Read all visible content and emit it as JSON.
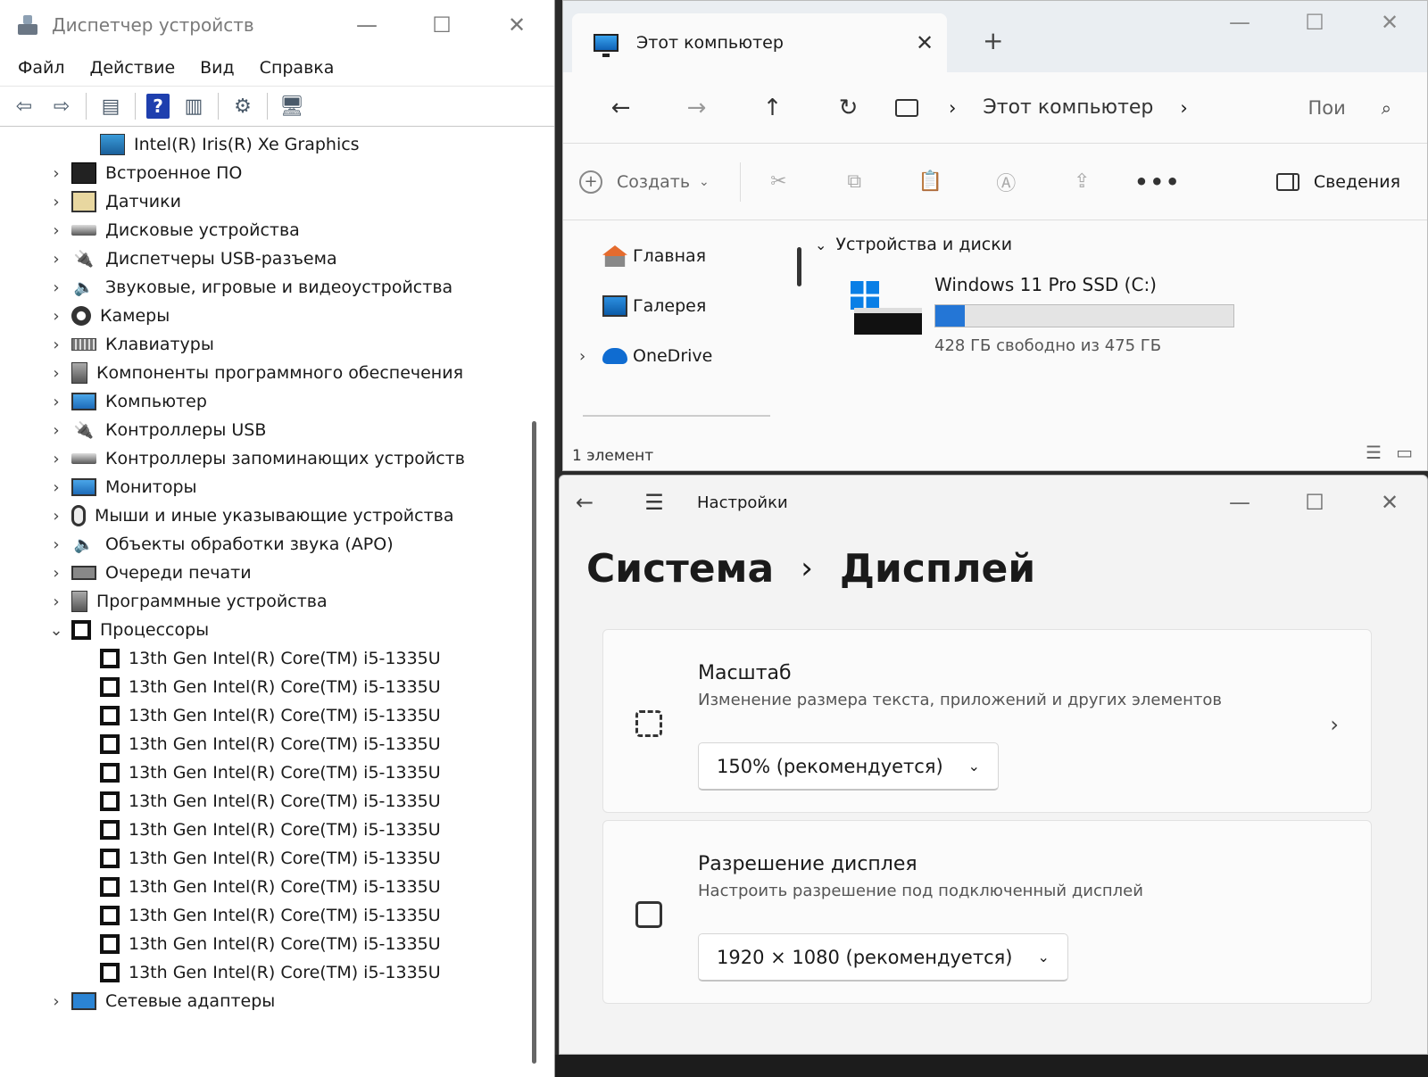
{
  "device_manager": {
    "title": "Диспетчер устройств",
    "menu": [
      "Файл",
      "Действие",
      "Вид",
      "Справка"
    ],
    "toolbar_icons": [
      "back-arrow-icon",
      "forward-arrow-icon",
      "properties-icon",
      "help-icon",
      "view-icon",
      "update-driver-icon",
      "scan-hardware-icon"
    ],
    "tree": [
      {
        "label": "Intel(R) Iris(R) Xe Graphics",
        "level": 1,
        "icon": "gpu"
      },
      {
        "label": "Встроенное ПО",
        "level": 0,
        "icon": "chip",
        "expanded": false
      },
      {
        "label": "Датчики",
        "level": 0,
        "icon": "board",
        "expanded": false
      },
      {
        "label": "Дисковые устройства",
        "level": 0,
        "icon": "disk",
        "expanded": false
      },
      {
        "label": "Диспетчеры USB-разъема",
        "level": 0,
        "icon": "usb",
        "expanded": false
      },
      {
        "label": "Звуковые, игровые и видеоустройства",
        "level": 0,
        "icon": "spk",
        "expanded": false
      },
      {
        "label": "Камеры",
        "level": 0,
        "icon": "cam",
        "expanded": false
      },
      {
        "label": "Клавиатуры",
        "level": 0,
        "icon": "kbd",
        "expanded": false
      },
      {
        "label": "Компоненты программного обеспечения",
        "level": 0,
        "icon": "box",
        "expanded": false
      },
      {
        "label": "Компьютер",
        "level": 0,
        "icon": "mon",
        "expanded": false
      },
      {
        "label": "Контроллеры USB",
        "level": 0,
        "icon": "usb",
        "expanded": false
      },
      {
        "label": "Контроллеры запоминающих устройств",
        "level": 0,
        "icon": "disk",
        "expanded": false
      },
      {
        "label": "Мониторы",
        "level": 0,
        "icon": "mon",
        "expanded": false
      },
      {
        "label": "Мыши и иные указывающие устройства",
        "level": 0,
        "icon": "mouse",
        "expanded": false
      },
      {
        "label": "Объекты обработки звука (APO)",
        "level": 0,
        "icon": "spk",
        "expanded": false
      },
      {
        "label": "Очереди печати",
        "level": 0,
        "icon": "printer",
        "expanded": false
      },
      {
        "label": "Программные устройства",
        "level": 0,
        "icon": "box",
        "expanded": false
      },
      {
        "label": "Процессоры",
        "level": 0,
        "icon": "cpu",
        "expanded": true
      },
      {
        "label": "13th Gen Intel(R) Core(TM) i5-1335U",
        "level": 1,
        "icon": "cpu"
      },
      {
        "label": "13th Gen Intel(R) Core(TM) i5-1335U",
        "level": 1,
        "icon": "cpu"
      },
      {
        "label": "13th Gen Intel(R) Core(TM) i5-1335U",
        "level": 1,
        "icon": "cpu"
      },
      {
        "label": "13th Gen Intel(R) Core(TM) i5-1335U",
        "level": 1,
        "icon": "cpu"
      },
      {
        "label": "13th Gen Intel(R) Core(TM) i5-1335U",
        "level": 1,
        "icon": "cpu"
      },
      {
        "label": "13th Gen Intel(R) Core(TM) i5-1335U",
        "level": 1,
        "icon": "cpu"
      },
      {
        "label": "13th Gen Intel(R) Core(TM) i5-1335U",
        "level": 1,
        "icon": "cpu"
      },
      {
        "label": "13th Gen Intel(R) Core(TM) i5-1335U",
        "level": 1,
        "icon": "cpu"
      },
      {
        "label": "13th Gen Intel(R) Core(TM) i5-1335U",
        "level": 1,
        "icon": "cpu"
      },
      {
        "label": "13th Gen Intel(R) Core(TM) i5-1335U",
        "level": 1,
        "icon": "cpu"
      },
      {
        "label": "13th Gen Intel(R) Core(TM) i5-1335U",
        "level": 1,
        "icon": "cpu"
      },
      {
        "label": "13th Gen Intel(R) Core(TM) i5-1335U",
        "level": 1,
        "icon": "cpu"
      },
      {
        "label": "Сетевые адаптеры",
        "level": 0,
        "icon": "net",
        "expanded": false
      }
    ]
  },
  "explorer": {
    "tab_label": "Этот компьютер",
    "breadcrumb": "Этот компьютер",
    "search_placeholder": "Пои",
    "create_label": "Создать",
    "details_label": "Сведения",
    "sidebar": [
      {
        "label": "Главная",
        "icon": "home"
      },
      {
        "label": "Галерея",
        "icon": "gal"
      },
      {
        "label": "OneDrive",
        "icon": "cloud",
        "expandable": true
      }
    ],
    "group_label": "Устройства и диски",
    "drive": {
      "name": "Windows 11 Pro SSD (C:)",
      "free_text": "428 ГБ свободно из 475 ГБ",
      "used_fraction": 0.099
    },
    "status": "1 элемент"
  },
  "settings": {
    "app_title": "Настройки",
    "crumb_parent": "Система",
    "crumb_current": "Дисплей",
    "cards": [
      {
        "title": "Масштаб",
        "description": "Изменение размера текста, приложений и других элементов",
        "value": "150% (рекомендуется)",
        "icon": "scale"
      },
      {
        "title": "Разрешение дисплея",
        "description": "Настроить разрешение под подключенный дисплей",
        "value": "1920 × 1080 (рекомендуется)",
        "icon": "resolution"
      }
    ]
  }
}
